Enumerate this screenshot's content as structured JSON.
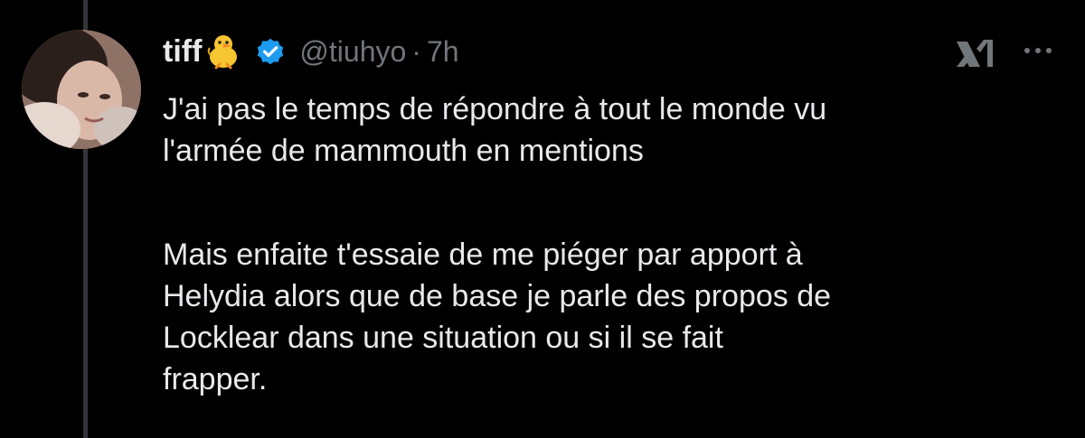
{
  "tweet": {
    "author_name": "tiff",
    "name_emoji_icon": "baby-chick-icon",
    "verified_icon": "verified-badge-icon",
    "handle": "@tiuhyo",
    "separator": "·",
    "time": "7h",
    "paragraphs": [
      [
        "J'ai pas le temps de répondre à tout le monde vu",
        "l'armée de mammouth en mentions"
      ],
      [
        "Mais enfaite t'essaie de me piéger par apport à",
        "Helydia alors que de base je parle des propos de",
        "Locklear dans une situation ou si il se fait",
        "frapper."
      ]
    ]
  },
  "actions": {
    "grok_icon": "xai-grok-icon",
    "more_icon": "more-options-icon"
  },
  "colors": {
    "background": "#000000",
    "text": "#e7e9ea",
    "secondary_text": "#71767b",
    "verified": "#1d9bf0",
    "thread_line": "#333639"
  }
}
